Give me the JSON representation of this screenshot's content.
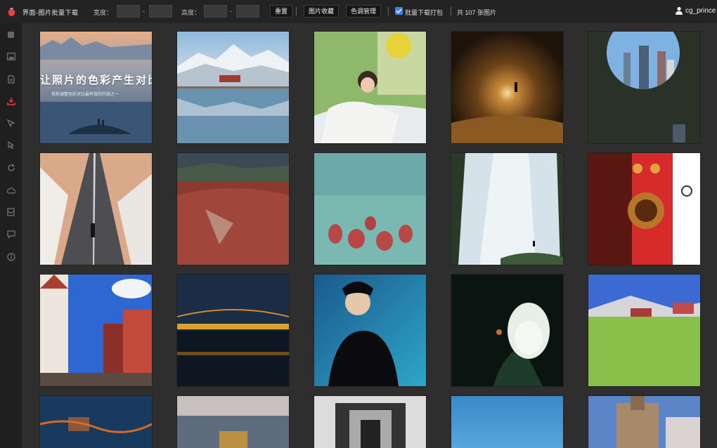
{
  "header": {
    "app_title": "界面-图片批量下载",
    "width_label": "宽度：",
    "height_label": "高度：",
    "dash": "-",
    "width_min": "",
    "width_max": "",
    "height_min": "",
    "height_max": "",
    "reset_label": "重置",
    "favorites_label": "图片收藏",
    "tone_label": "色调管理",
    "batch_label": "批量下载打包",
    "batch_checked": true,
    "count_text": "共 107 张图片",
    "username": "cg_prince"
  },
  "sidebar": {
    "icons": [
      "square-icon",
      "image-icon",
      "document-icon",
      "download-icon",
      "cursor-icon",
      "pointer-icon",
      "refresh-icon",
      "cloud-icon",
      "mail-icon",
      "chat-icon",
      "info-icon"
    ],
    "active_index": 3,
    "active_color": "#e23a3a"
  },
  "gallery": {
    "first_tile_title": "让照片的色彩产生对比",
    "first_tile_subtitle": "目前调整色彩对比最有效的内容之一",
    "tiles": [
      {
        "name": "misty-mountains-photo",
        "colors": [
          "#e8b38d",
          "#8c96a8",
          "#2f4a6a"
        ]
      },
      {
        "name": "snow-mountain-palace-photo",
        "colors": [
          "#9fc3e0",
          "#dfe7ee",
          "#5f87a3"
        ]
      },
      {
        "name": "girl-sitting-photo",
        "colors": [
          "#6aa255",
          "#d7dfe4",
          "#f2f2f0"
        ]
      },
      {
        "name": "forest-tunnel-photo",
        "colors": [
          "#2a1c10",
          "#8a5a22",
          "#c79042"
        ]
      },
      {
        "name": "round-window-city-photo",
        "colors": [
          "#2a3126",
          "#31382a",
          "#252a21"
        ]
      },
      {
        "name": "snow-road-person-photo",
        "colors": [
          "#d4a98a",
          "#e9e4e0",
          "#4a4a4e"
        ]
      },
      {
        "name": "monastery-town-photo",
        "colors": [
          "#3b4a55",
          "#8a3a30",
          "#b04a3a"
        ]
      },
      {
        "name": "monks-lake-photo",
        "colors": [
          "#5fa2a1",
          "#7dbab4",
          "#b34a4a"
        ]
      },
      {
        "name": "waterfall-photo",
        "colors": [
          "#2a3a26",
          "#dfe8ee",
          "#8fa59b"
        ]
      },
      {
        "name": "red-door-knocker-photo",
        "colors": [
          "#6a1a12",
          "#d62a2a",
          "#ffffff"
        ]
      },
      {
        "name": "european-street-photo",
        "colors": [
          "#2e66d2",
          "#f4f0ea",
          "#8a3028"
        ]
      },
      {
        "name": "night-bridge-photo",
        "colors": [
          "#1a2d45",
          "#e0a030",
          "#0e1622"
        ]
      },
      {
        "name": "woman-portrait-photo",
        "colors": [
          "#1a5a8c",
          "#2ea6c8",
          "#0b0b0f"
        ]
      },
      {
        "name": "white-lotus-photo",
        "colors": [
          "#0a1410",
          "#e8efe6",
          "#1e3a28"
        ]
      },
      {
        "name": "meadow-house-photo",
        "colors": [
          "#3a6ad2",
          "#8ac04a",
          "#d6d6da"
        ]
      },
      {
        "name": "city-night-aerial-photo",
        "colors": [
          "#173a5e",
          "#d86a24",
          "#2a4a7a"
        ]
      },
      {
        "name": "sunset-lake-photo",
        "colors": [
          "#c9c0be",
          "#5f6c7e",
          "#e2a02a"
        ]
      },
      {
        "name": "bw-corridor-photo",
        "colors": [
          "#222222",
          "#dcdcdc",
          "#777777"
        ]
      },
      {
        "name": "blue-sea-photo",
        "colors": [
          "#3b89c8",
          "#5aa8dd",
          "#2c78bb"
        ]
      },
      {
        "name": "castle-photo",
        "colors": [
          "#5c84c8",
          "#a68a6a",
          "#d8d2d0"
        ]
      }
    ]
  }
}
